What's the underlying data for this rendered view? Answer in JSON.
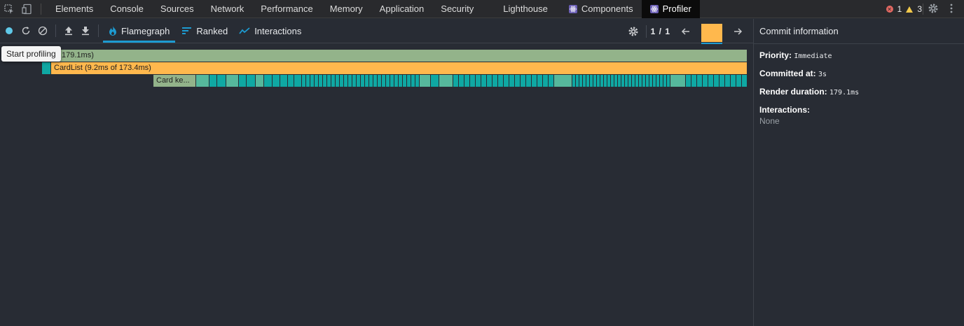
{
  "devtools": {
    "tabs": [
      "Elements",
      "Console",
      "Sources",
      "Network",
      "Performance",
      "Memory",
      "Application",
      "Security",
      "Lighthouse"
    ],
    "react_tabs": [
      "Components",
      "Profiler"
    ],
    "active_tab": "Profiler",
    "error_count": "1",
    "warning_count": "3"
  },
  "profiler": {
    "tabs": [
      {
        "label": "Flamegraph",
        "icon": "flame-icon",
        "active": true
      },
      {
        "label": "Ranked",
        "icon": "ranked-icon",
        "active": false
      },
      {
        "label": "Interactions",
        "icon": "interactions-icon",
        "active": false
      }
    ],
    "commit_counter": "1 / 1",
    "tooltip": "Start profiling",
    "colors": {
      "record": "#5fc8e8",
      "accent": "#1d9bd1",
      "commit": "#ffb84d"
    }
  },
  "flamegraph": {
    "root_label": "179.1ms)",
    "cardlist_label": "CardList (9.2ms of 173.4ms)",
    "card_label": "Card ke..."
  },
  "sidebar": {
    "title": "Commit information",
    "priority_label": "Priority:",
    "priority_value": "Immediate",
    "committed_label": "Committed at:",
    "committed_value": "3s",
    "render_label": "Render duration:",
    "render_value": "179.1ms",
    "interactions_label": "Interactions:",
    "interactions_value": "None"
  }
}
